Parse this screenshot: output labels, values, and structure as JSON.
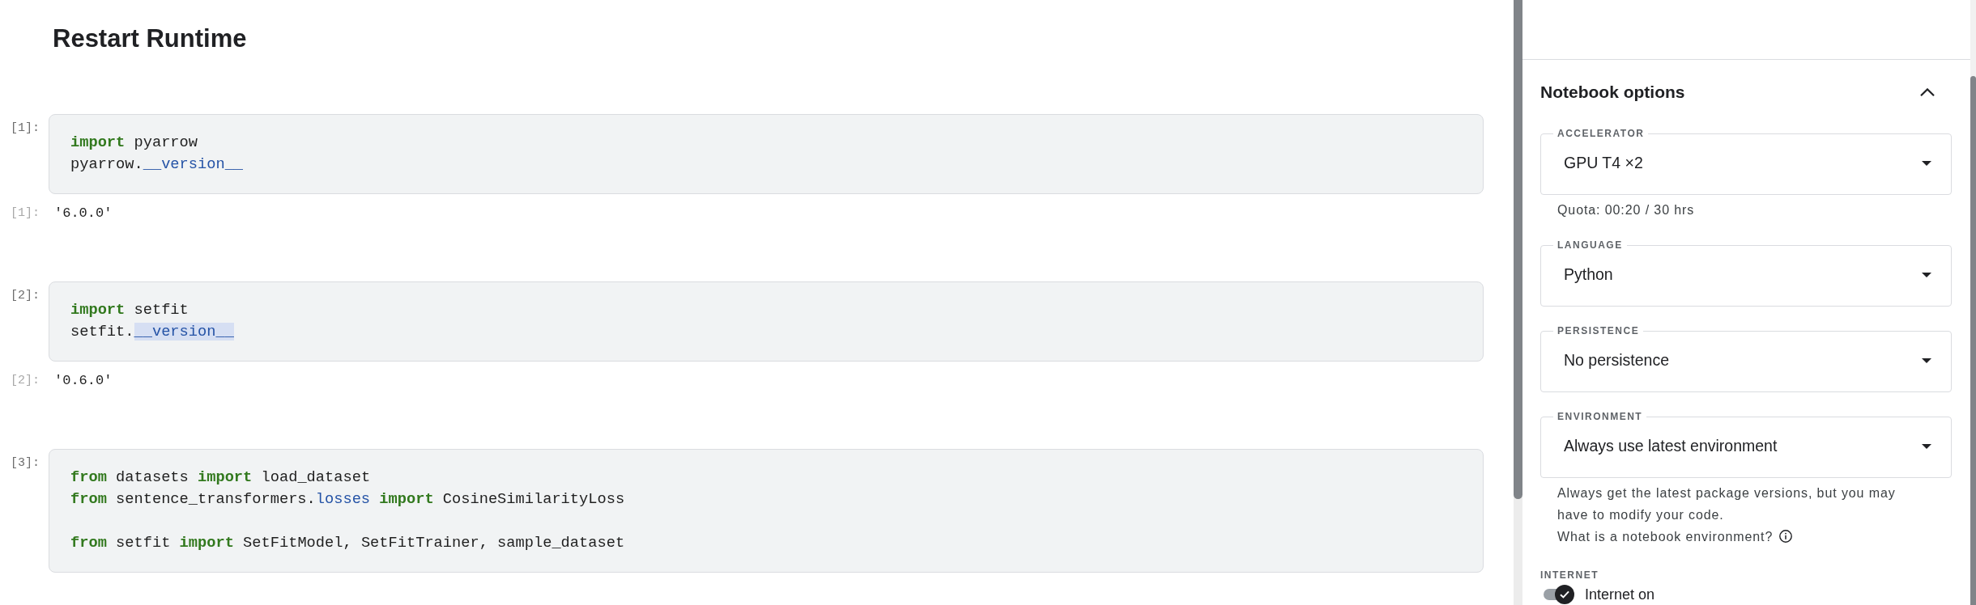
{
  "notebook": {
    "heading": "Restart Runtime",
    "cells": [
      {
        "prompt": "[1]:",
        "lines": [
          {
            "kind": "code",
            "tokens": [
              {
                "text": "import",
                "kind": "keyword",
                "highlighted": false
              },
              {
                "text": " pyarrow",
                "kind": "name",
                "highlighted": false
              }
            ]
          },
          {
            "kind": "code",
            "tokens": [
              {
                "text": "pyarrow.",
                "kind": "name",
                "highlighted": false
              },
              {
                "text": "__version__",
                "kind": "attribute",
                "highlighted": false
              }
            ]
          }
        ],
        "output": {
          "prompt": "[1]:",
          "text": "'6.0.0'"
        }
      },
      {
        "prompt": "[2]:",
        "lines": [
          {
            "kind": "code",
            "tokens": [
              {
                "text": "import",
                "kind": "keyword",
                "highlighted": false
              },
              {
                "text": " setfit",
                "kind": "name",
                "highlighted": false
              }
            ]
          },
          {
            "kind": "code",
            "tokens": [
              {
                "text": "setfit.",
                "kind": "name",
                "highlighted": false
              },
              {
                "text": "__version__",
                "kind": "attribute",
                "highlighted": true
              }
            ]
          }
        ],
        "output": {
          "prompt": "[2]:",
          "text": "'0.6.0'"
        }
      },
      {
        "prompt": "[3]:",
        "lines": [
          {
            "kind": "code",
            "tokens": [
              {
                "text": "from",
                "kind": "keyword",
                "highlighted": false
              },
              {
                "text": " datasets ",
                "kind": "name",
                "highlighted": false
              },
              {
                "text": "import",
                "kind": "keyword",
                "highlighted": false
              },
              {
                "text": " load_dataset",
                "kind": "name",
                "highlighted": false
              }
            ]
          },
          {
            "kind": "code",
            "tokens": [
              {
                "text": "from",
                "kind": "keyword",
                "highlighted": false
              },
              {
                "text": " sentence_transformers.",
                "kind": "name",
                "highlighted": false
              },
              {
                "text": "losses",
                "kind": "attribute",
                "highlighted": false
              },
              {
                "text": " import",
                "kind": "keyword",
                "highlighted": false
              },
              {
                "text": " CosineSimilarityLoss",
                "kind": "name",
                "highlighted": false
              }
            ]
          },
          {
            "kind": "blank"
          },
          {
            "kind": "code",
            "tokens": [
              {
                "text": "from",
                "kind": "keyword",
                "highlighted": false
              },
              {
                "text": " setfit ",
                "kind": "name",
                "highlighted": false
              },
              {
                "text": "import",
                "kind": "keyword",
                "highlighted": false
              },
              {
                "text": " SetFitModel, SetFitTrainer, sample_dataset",
                "kind": "name",
                "highlighted": false
              }
            ]
          }
        ]
      }
    ]
  },
  "notebook_options": {
    "title": "Notebook options",
    "expanded": true,
    "fields": [
      {
        "kind": "select",
        "label": "ACCELERATOR",
        "value": "GPU T4 ×2",
        "hint": {
          "text": "Quota: 00:20 / 30 hrs",
          "info_icon": false
        }
      },
      {
        "kind": "select",
        "label": "LANGUAGE",
        "value": "Python"
      },
      {
        "kind": "select",
        "label": "PERSISTENCE",
        "value": "No persistence"
      },
      {
        "kind": "select",
        "label": "ENVIRONMENT",
        "value": "Always use latest environment",
        "hint": {
          "text": "Always get the latest package versions, but you may have to modify your code.",
          "link": "What is a notebook environment?",
          "info_icon": true
        }
      },
      {
        "kind": "toggle",
        "label": "INTERNET",
        "toggle_label": "Internet on",
        "on": true
      }
    ]
  }
}
